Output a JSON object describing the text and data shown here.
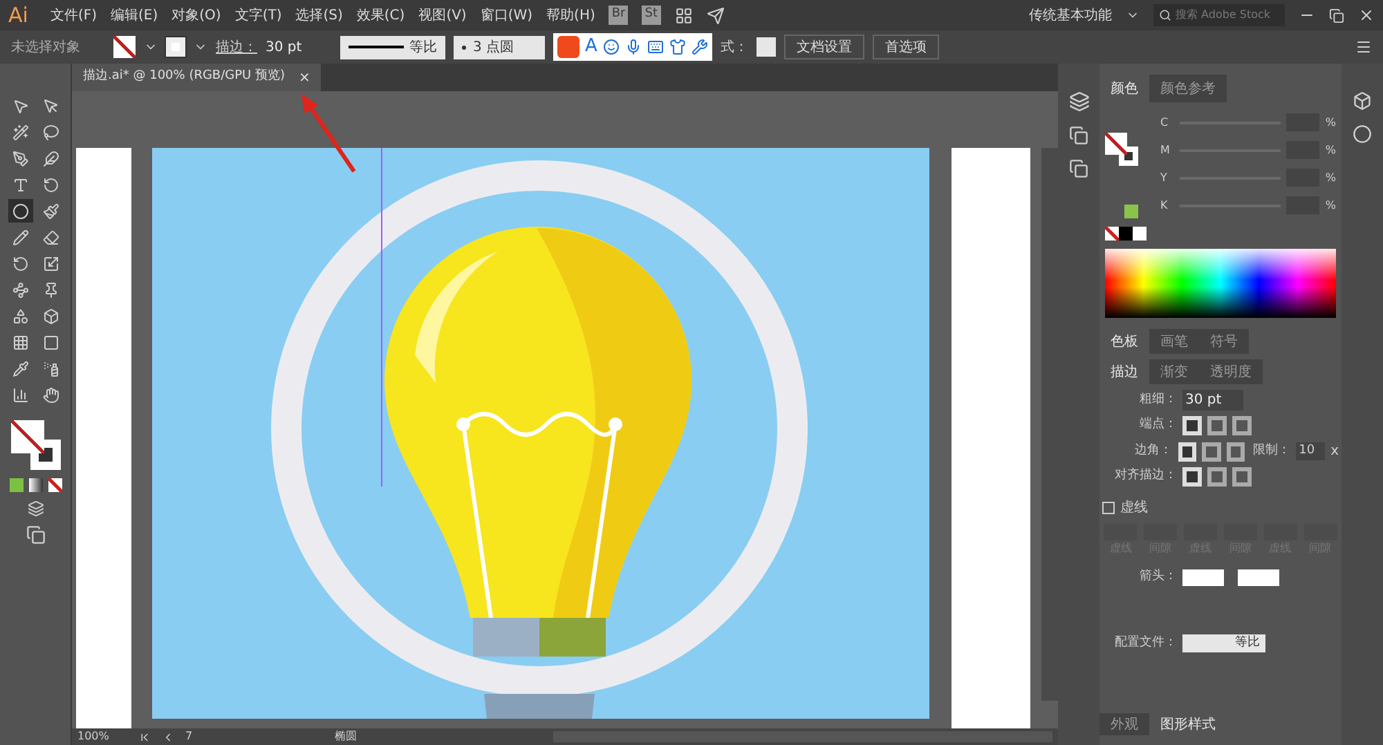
{
  "app": {
    "logo": "Ai"
  },
  "menu": [
    "文件(F)",
    "编辑(E)",
    "对象(O)",
    "文字(T)",
    "选择(S)",
    "效果(C)",
    "视图(V)",
    "窗口(W)",
    "帮助(H)"
  ],
  "bridges": [
    "Br",
    "St"
  ],
  "workspace": "传统基本功能",
  "search": {
    "placeholder": "搜索 Adobe Stock"
  },
  "control_bar": {
    "selection": "未选择对象",
    "stroke_label": "描边：",
    "stroke_weight": "30 pt",
    "profile": "等比",
    "brush": "3 点圆",
    "ime_letter": "A",
    "style_label": "式：",
    "buttons": [
      "文档设置",
      "首选项"
    ]
  },
  "document_tab": {
    "title": "描边.ai* @ 100% (RGB/GPU 预览)",
    "close": "×"
  },
  "tools": [
    {
      "selected": false
    },
    {
      "selected": false
    },
    {
      "selected": false
    },
    {
      "selected": false
    },
    {
      "selected": false
    },
    {
      "selected": false
    },
    {
      "selected": false
    },
    {
      "selected": false
    },
    {
      "selected": true
    },
    {
      "selected": false
    },
    {
      "selected": false
    },
    {
      "selected": false
    },
    {
      "selected": false
    },
    {
      "selected": false
    },
    {
      "selected": false
    },
    {
      "selected": false
    },
    {
      "selected": false
    },
    {
      "selected": false
    },
    {
      "selected": false
    },
    {
      "selected": false
    },
    {
      "selected": false
    },
    {
      "selected": false
    },
    {
      "selected": false
    },
    {
      "selected": false
    }
  ],
  "color_panel": {
    "tabs": [
      {
        "label": "颜色",
        "selected": true
      },
      {
        "label": "颜色参考",
        "selected": false
      }
    ],
    "channels": [
      "C",
      "M",
      "Y",
      "K"
    ],
    "units": "%"
  },
  "swatch_tabs": [
    {
      "label": "色板",
      "selected": true
    },
    {
      "label": "画笔",
      "selected": false
    },
    {
      "label": "符号",
      "selected": false
    }
  ],
  "stroke_panel": {
    "tabs": [
      {
        "label": "描边",
        "selected": true
      },
      {
        "label": "渐变",
        "selected": false
      },
      {
        "label": "透明度",
        "selected": false
      }
    ],
    "weight_label": "粗细：",
    "weight": "30 pt",
    "cap_label": "端点：",
    "corner_label": "边角：",
    "limit_label": "限制：",
    "limit": "10",
    "limit_unit": "x",
    "align_label": "对齐描边：",
    "dashed": {
      "label": "虚线",
      "checked": false
    },
    "dash_fields": [
      "虚线",
      "间隙",
      "虚线",
      "间隙",
      "虚线",
      "间隙"
    ],
    "arrow_label": "箭头：",
    "profile_label": "配置文件：",
    "profile": "等比"
  },
  "bottom_tabs": [
    {
      "label": "外观",
      "selected": false
    },
    {
      "label": "图形样式",
      "selected": true
    }
  ],
  "status_bar": {
    "zoom": "100%",
    "artboard": "7",
    "tool": "椭圆"
  }
}
